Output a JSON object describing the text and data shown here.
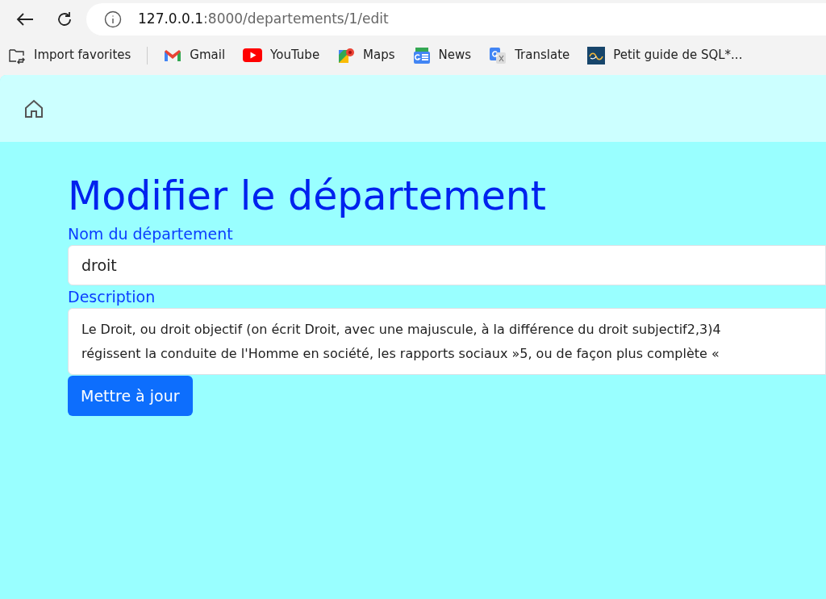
{
  "browser": {
    "url_host": "127.0.0.1",
    "url_path": ":8000/departements/1/edit",
    "bookmarks": [
      {
        "label": "Import favorites",
        "kind": "import"
      },
      {
        "label": "Gmail",
        "kind": "gmail"
      },
      {
        "label": "YouTube",
        "kind": "youtube"
      },
      {
        "label": "Maps",
        "kind": "maps"
      },
      {
        "label": "News",
        "kind": "news"
      },
      {
        "label": "Translate",
        "kind": "translate"
      },
      {
        "label": "Petit guide de SQL*...",
        "kind": "site"
      }
    ]
  },
  "page": {
    "title": "Modifier le département",
    "fields": [
      {
        "label": "Nom du département",
        "kind": "input",
        "value": "droit"
      },
      {
        "label": "Description",
        "kind": "textarea",
        "lines": [
          "Le Droit, ou droit objectif (on écrit Droit, avec une majuscule, à la différence du droit subjectif2,3)4",
          "régissent la conduite de l'Homme en société, les rapports sociaux »5, ou de façon plus complète «"
        ]
      }
    ],
    "submit": "Mettre à jour"
  }
}
